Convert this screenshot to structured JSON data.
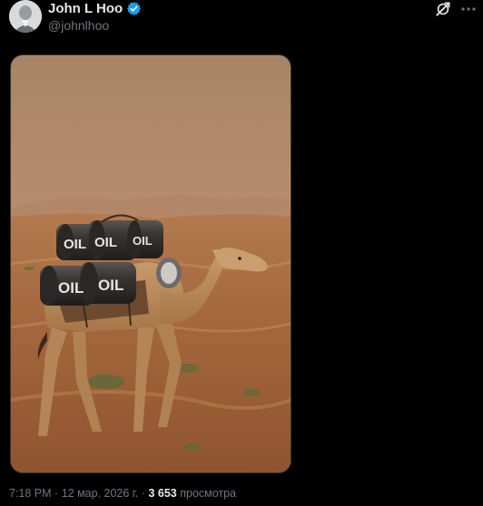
{
  "tweet": {
    "author": {
      "display_name": "John L Hoo",
      "handle": "@johnlhoo",
      "verified": true,
      "avatar_icon": "avatar-photo"
    },
    "icons": [
      "verified-badge-icon",
      "grok-icon",
      "more-icon"
    ],
    "media": {
      "kind": "image",
      "barrel_labels": [
        "OIL",
        "OIL",
        "OIL",
        "OIL",
        "OIL"
      ]
    },
    "meta": {
      "time": "7:18 PM",
      "separator": "·",
      "date": "12 мар. 2026 г.",
      "views_count": "3 653",
      "views_label": "просмотра"
    }
  },
  "colors": {
    "background": "#000000",
    "text_primary": "#e7e9ea",
    "text_secondary": "#71767b",
    "verified_blue": "#1d9bf0",
    "sky": "#b48a68",
    "sand": "#a8693d"
  }
}
